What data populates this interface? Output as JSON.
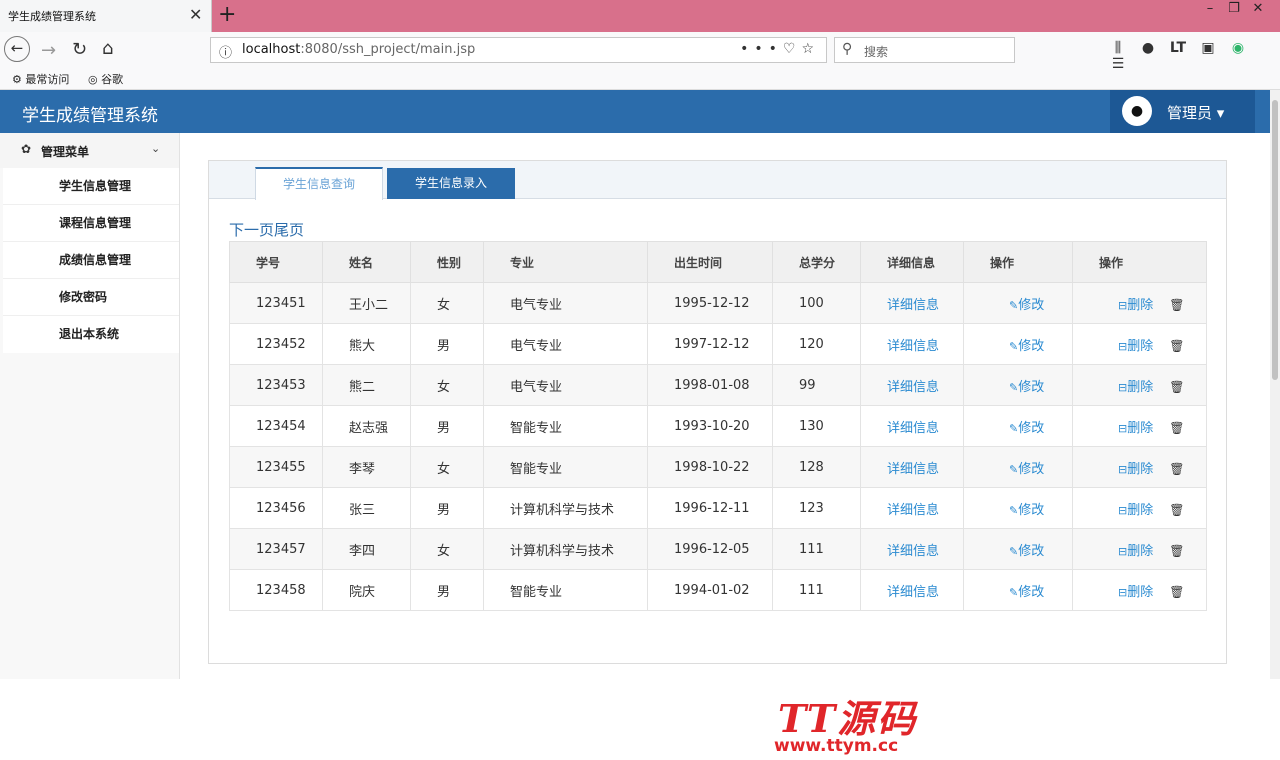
{
  "browser": {
    "tab_title": "学生成绩管理系统",
    "tab_close": "✕",
    "new_tab": "+",
    "url_host": "localhost",
    "url_rest": ":8080/ssh_project/main.jsp",
    "search_placeholder": "搜索",
    "bookmarks": [
      "最常访问",
      "谷歌"
    ]
  },
  "app": {
    "title": "学生成绩管理系统",
    "user_label": "管理员 ▾",
    "colors": {
      "header": "#2b6cab",
      "user_box": "#1d5895",
      "link": "#2b8bd1"
    }
  },
  "sidebar": {
    "title": "管理菜单",
    "items": [
      {
        "label": "学生信息管理"
      },
      {
        "label": "课程信息管理"
      },
      {
        "label": "成绩信息管理"
      },
      {
        "label": "修改密码"
      },
      {
        "label": "退出本系统"
      }
    ]
  },
  "tabs": {
    "query": "学生信息查询",
    "entry": "学生信息录入"
  },
  "pager": {
    "next": "下一页",
    "last": "尾页"
  },
  "table": {
    "headers": [
      "学号",
      "姓名",
      "性别",
      "专业",
      "出生时间",
      "总学分",
      "详细信息",
      "操作",
      "操作"
    ],
    "detail_label": "详细信息",
    "edit_label": "修改",
    "delete_label": "删除",
    "rows": [
      {
        "id": "123451",
        "name": "王小二",
        "gender": "女",
        "major": "电气专业",
        "birth": "1995-12-12",
        "credits": "100"
      },
      {
        "id": "123452",
        "name": "熊大",
        "gender": "男",
        "major": "电气专业",
        "birth": "1997-12-12",
        "credits": "120"
      },
      {
        "id": "123453",
        "name": "熊二",
        "gender": "女",
        "major": "电气专业",
        "birth": "1998-01-08",
        "credits": "99"
      },
      {
        "id": "123454",
        "name": "赵志强",
        "gender": "男",
        "major": "智能专业",
        "birth": "1993-10-20",
        "credits": "130"
      },
      {
        "id": "123455",
        "name": "李琴",
        "gender": "女",
        "major": "智能专业",
        "birth": "1998-10-22",
        "credits": "128"
      },
      {
        "id": "123456",
        "name": "张三",
        "gender": "男",
        "major": "计算机科学与技术",
        "birth": "1996-12-11",
        "credits": "123"
      },
      {
        "id": "123457",
        "name": "李四",
        "gender": "女",
        "major": "计算机科学与技术",
        "birth": "1996-12-05",
        "credits": "111"
      },
      {
        "id": "123458",
        "name": "院庆",
        "gender": "男",
        "major": "智能专业",
        "birth": "1994-01-02",
        "credits": "111"
      }
    ]
  },
  "watermark": {
    "big": "TT源码",
    "small": "www.ttym.cc"
  }
}
